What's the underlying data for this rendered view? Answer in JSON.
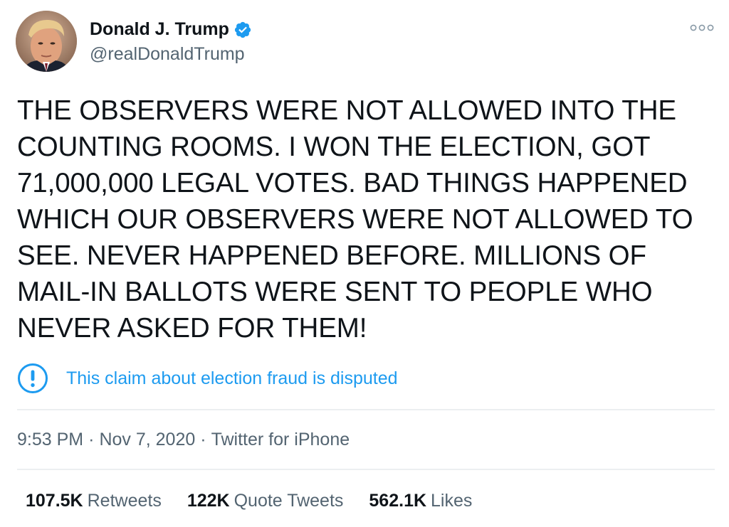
{
  "author": {
    "display_name": "Donald J. Trump",
    "handle": "@realDonaldTrump",
    "avatar_icon": "profile-photo",
    "verified_icon": "verified-badge-icon"
  },
  "menu": {
    "icon": "more-options-icon"
  },
  "tweet": {
    "text": "THE OBSERVERS WERE NOT ALLOWED INTO THE\nCOUNTING ROOMS. I WON THE ELECTION, GOT\n71,000,000 LEGAL VOTES. BAD THINGS HAPPENED\nWHICH OUR OBSERVERS WERE NOT ALLOWED TO\nSEE. NEVER HAPPENED BEFORE. MILLIONS OF\nMAIL-IN BALLOTS WERE SENT TO PEOPLE WHO\nNEVER ASKED FOR THEM!"
  },
  "notice": {
    "icon": "exclamation-circle-icon",
    "text": "This claim about election fraud is disputed"
  },
  "meta": {
    "time": "9:53 PM",
    "separator": "·",
    "date": "Nov 7, 2020",
    "source": "Twitter for iPhone"
  },
  "stats": {
    "retweets_count": "107.5K",
    "retweets_label": "Retweets",
    "quotes_count": "122K",
    "quotes_label": "Quote Tweets",
    "likes_count": "562.1K",
    "likes_label": "Likes"
  },
  "colors": {
    "accent": "#1d9bf0",
    "text_primary": "#0f1419",
    "text_secondary": "#536471",
    "divider": "#eceff1"
  }
}
